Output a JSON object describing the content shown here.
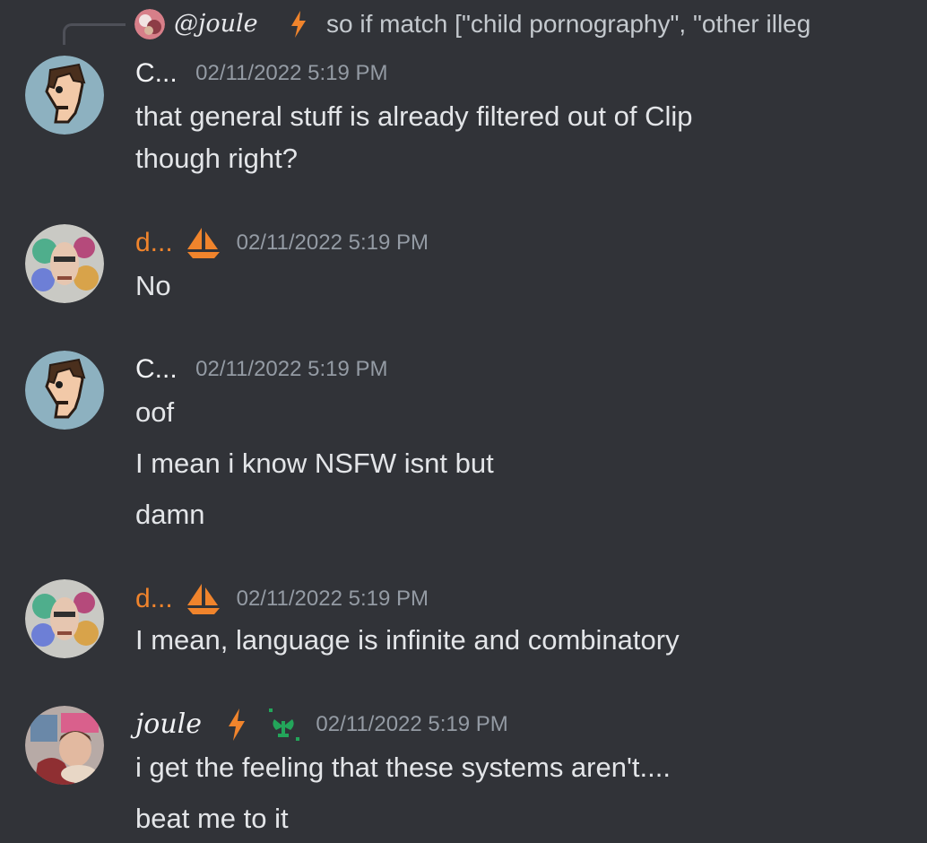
{
  "reply": {
    "author": "@joule",
    "text": "so if match [\"child pornography\", \"other illeg"
  },
  "messages": [
    {
      "author": "C...",
      "timestamp": "02/11/2022 5:19 PM",
      "lines": [
        "that general stuff is already filtered out of Clip",
        "though right?"
      ]
    },
    {
      "author": "d...",
      "timestamp": "02/11/2022 5:19 PM",
      "lines": [
        "No"
      ]
    },
    {
      "author": "C...",
      "timestamp": "02/11/2022 5:19 PM",
      "lines": [
        "oof",
        "I mean i know NSFW isnt but",
        "damn"
      ]
    },
    {
      "author": "d...",
      "timestamp": "02/11/2022 5:19 PM",
      "lines": [
        "I mean, language is infinite and combinatory"
      ]
    },
    {
      "author": "joule",
      "timestamp": "02/11/2022 5:19 PM",
      "lines": [
        "i get the feeling that these systems aren't....",
        "beat me to it"
      ]
    }
  ],
  "colors": {
    "background": "#313338",
    "orange_name": "#f0842c",
    "timestamp": "#949ba4",
    "text": "#e3e5e8",
    "green_badge": "#23a55a"
  },
  "icons": {
    "reply_badge": "lightning-icon",
    "d_badge": "sailboat-icon",
    "joule_badge_1": "lightning-icon",
    "joule_badge_2": "plant-icon"
  }
}
